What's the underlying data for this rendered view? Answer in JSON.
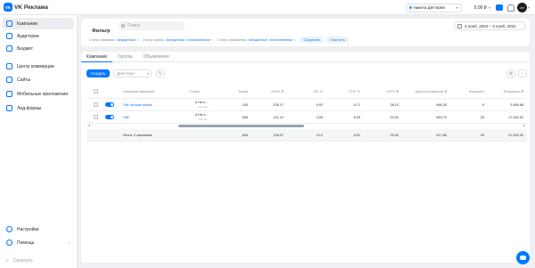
{
  "app": {
    "logo_text": "VK",
    "title": "VK Реклама"
  },
  "header": {
    "user_name": "Никита Дегтярев",
    "balance": "0,00 ₽",
    "avatar_text": "ИП"
  },
  "sidebar": {
    "items": [
      {
        "label": "Кампании",
        "icon": "campaigns-icon",
        "active": true
      },
      {
        "label": "Аудитории",
        "icon": "audiences-icon"
      },
      {
        "label": "Бюджет",
        "icon": "budget-icon"
      },
      {
        "label": "Центр коммерции",
        "icon": "commerce-icon"
      },
      {
        "label": "Сайты",
        "icon": "sites-icon"
      },
      {
        "label": "Мобильные приложения",
        "icon": "mobile-apps-icon"
      },
      {
        "label": "Лид-формы",
        "icon": "lead-forms-icon"
      }
    ],
    "bottom_items": [
      {
        "label": "Настройки",
        "icon": "settings-icon"
      },
      {
        "label": "Помощь",
        "icon": "help-icon",
        "arrow": "›"
      }
    ],
    "collapse_label": "Свернуть",
    "collapse_icon": "«"
  },
  "filter": {
    "title": "Фильтр",
    "search_placeholder": "Поиск",
    "date_range": "4 нояб. 2022 – 4 нояб. 2023",
    "chips": [
      {
        "key": "Статус кампании:",
        "value": "Запущенные"
      },
      {
        "key": "Статус группы:",
        "value": "Запущенные, Остановленные"
      },
      {
        "key": "Статус объявления:",
        "value": "Запущенные, Остановленные"
      }
    ],
    "save_label": "Сохранить",
    "clear_label": "Очистить"
  },
  "tabs": [
    "Кампании",
    "Группы",
    "Объявления"
  ],
  "toolbar": {
    "create_label": "Создать",
    "actions_label": "Действия",
    "refresh_icon": "↻",
    "settings_icon": "⚙",
    "download_icon": "↓"
  },
  "table": {
    "columns": [
      "Название кампании",
      "Статус",
      "Клики",
      "eCPC ₽",
      "CR, %",
      "CTR, %",
      "eCPC ₽",
      "Цена за результат ₽",
      "Результат",
      "Потрачено ₽"
    ],
    "rows": [
      {
        "name": "Гмб лучшие минск",
        "status": "На п...",
        "status_sub": "Нет ак...",
        "values": [
          "150",
          "208.17",
          "6.92",
          "8.71",
          "28.13",
          "486.30",
          "9",
          "3 656.68"
        ]
      },
      {
        "name": "Гмб",
        "status": "На п...",
        "status_sub": "Нет ак...",
        "values": [
          "696",
          "121.12",
          "3.59",
          "8.49",
          "24.92",
          "683.75",
          "25",
          "17 343.32"
        ]
      }
    ],
    "total": {
      "label": "Итого: 2 кампании",
      "values": [
        "826",
        "138.07",
        "4.12",
        "8.51",
        "25.42",
        "617.85",
        "34",
        "21 000.00"
      ]
    }
  },
  "colors": {
    "accent": "#0077ff",
    "background": "#eef0f3",
    "card": "#ffffff"
  }
}
